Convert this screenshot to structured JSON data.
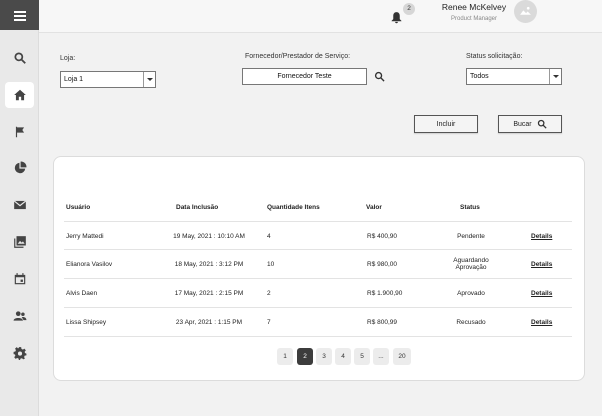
{
  "header": {
    "notification_count": "2",
    "user_name": "Renee McKelvey",
    "user_role": "Product Manager"
  },
  "sidebar": {
    "items": [
      {
        "icon": "search-icon"
      },
      {
        "icon": "home-icon",
        "active": true
      },
      {
        "icon": "flag-icon"
      },
      {
        "icon": "pie-chart-icon"
      },
      {
        "icon": "mail-icon"
      },
      {
        "icon": "images-icon"
      },
      {
        "icon": "calendar-icon"
      },
      {
        "icon": "users-icon"
      },
      {
        "icon": "gear-icon"
      }
    ]
  },
  "filters": {
    "store_label": "Loja:",
    "store_value": "Loja 1",
    "supplier_label": "Fornecedor/Prestador de Serviço:",
    "supplier_value": "Fornecedor Teste",
    "status_label": "Status solicitação:",
    "status_value": "Todos"
  },
  "actions": {
    "include_label": "Incluir",
    "search_label": "Bucar"
  },
  "table": {
    "columns": [
      "Usuário",
      "Data Inclusão",
      "Quantidade Itens",
      "Valor",
      "Status"
    ],
    "rows": [
      {
        "user": "Jerry Mattedi",
        "date": "19 May, 2021 : 10:10 AM",
        "qty": "4",
        "value": "R$ 400,90",
        "status": "Pendente",
        "details": "Details"
      },
      {
        "user": "Elianora Vasilov",
        "date": "18 May, 2021 : 3:12 PM",
        "qty": "10",
        "value": "R$ 980,00",
        "status_line1": "Aguardando",
        "status_line2": "Aprovação",
        "details": "Details"
      },
      {
        "user": "Alvis Daen",
        "date": "17 May, 2021 : 2:15 PM",
        "qty": "2",
        "value": "R$ 1.900,90",
        "status": "Aprovado",
        "details": "Details"
      },
      {
        "user": "Lissa Shipsey",
        "date": "23 Apr, 2021 : 1:15 PM",
        "qty": "7",
        "value": "R$ 800,99",
        "status": "Recusado",
        "details": "Details"
      }
    ]
  },
  "pagination": {
    "pages": [
      "1",
      "2",
      "3",
      "4",
      "5",
      "...",
      "20"
    ],
    "active": "2"
  },
  "colors": {
    "menu_bg": "#4a4a4a",
    "active_page": "#3c3c3c"
  }
}
